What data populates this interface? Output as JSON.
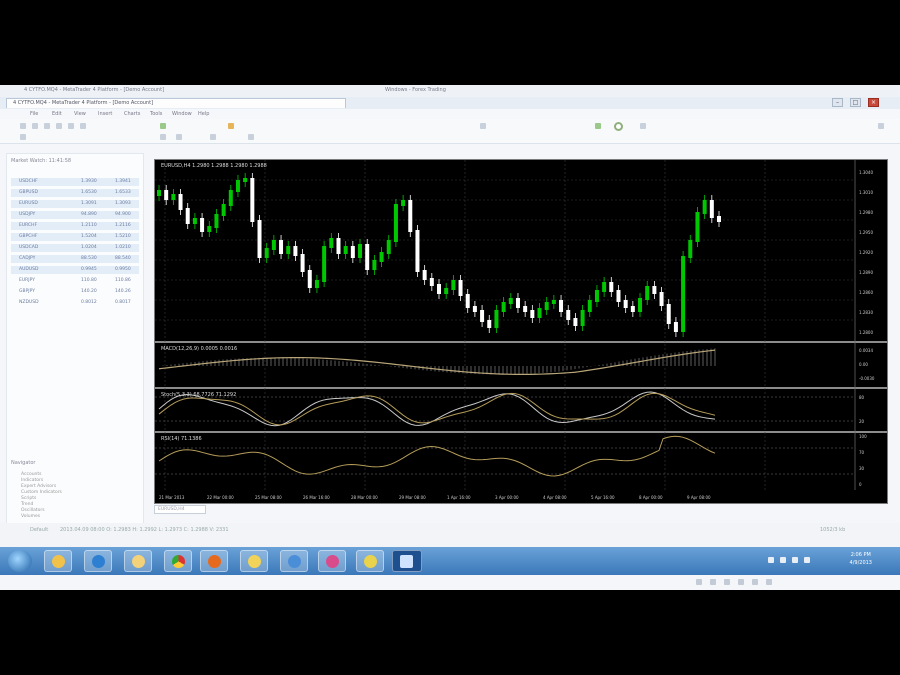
{
  "browser": {
    "window_title": "4 CYTFO.MQ4 - MetaTrader 4 Platform - [Demo Account]",
    "page_title": "Windows - Forex Trading"
  },
  "menu": {
    "items": [
      "File",
      "Edit",
      "View",
      "Insert",
      "Charts",
      "Tools",
      "Window",
      "Help"
    ]
  },
  "market_watch": {
    "title": "Market Watch: 11:41:58",
    "rows": [
      {
        "symbol": "USDCHF",
        "bid": "1.3930",
        "ask": "1.3941"
      },
      {
        "symbol": "GBPUSD",
        "bid": "1.6530",
        "ask": "1.6533"
      },
      {
        "symbol": "EURUSD",
        "bid": "1.3091",
        "ask": "1.3093"
      },
      {
        "symbol": "USDJPY",
        "bid": "94.890",
        "ask": "94.900"
      },
      {
        "symbol": "EURCHF",
        "bid": "1.2110",
        "ask": "1.2116"
      },
      {
        "symbol": "GBPCHF",
        "bid": "1.5204",
        "ask": "1.5210"
      },
      {
        "symbol": "USDCAD",
        "bid": "1.0204",
        "ask": "1.0210"
      },
      {
        "symbol": "CADJPY",
        "bid": "88.530",
        "ask": "88.540"
      },
      {
        "symbol": "AUDUSD",
        "bid": "0.9945",
        "ask": "0.9950"
      },
      {
        "symbol": "EURJPY",
        "bid": "110.80",
        "ask": "110.86"
      },
      {
        "symbol": "GBPJPY",
        "bid": "140.20",
        "ask": "140.26"
      },
      {
        "symbol": "NZDUSD",
        "bid": "0.8012",
        "ask": "0.8017"
      }
    ]
  },
  "navigator": {
    "title": "Navigator",
    "items": [
      "Accounts",
      "Indicators",
      "Expert Advisors",
      "Custom Indicators",
      "Scripts",
      "Trend",
      "Oscillators",
      "Volumes"
    ]
  },
  "chart": {
    "header": "EURUSD,H4  1.2980 1.2988 1.2980 1.2988",
    "macd_label": "MACD(12,26,9) 0.0005 0.0016",
    "stoch_label": "Stoch(5,3,3) 68.7726 71.1292",
    "rsi_label": "RSI(14) 71.1386",
    "price_ticks": [
      "1.3040",
      "1.3010",
      "1.2980",
      "1.2950",
      "1.2920",
      "1.2890",
      "1.2860",
      "1.2830",
      "1.2800"
    ],
    "macd_ticks": [
      "0.0034",
      "0.00",
      "-0.0030"
    ],
    "stoch_ticks": [
      "80",
      "20"
    ],
    "rsi_ticks": [
      "100",
      "70",
      "30",
      "0"
    ],
    "x_ticks": [
      "21 Mar 2013",
      "22 Mar 00:00",
      "25 Mar 08:00",
      "26 Mar 16:00",
      "28 Mar 00:00",
      "29 Mar 08:00",
      "1 Apr 16:00",
      "3 Apr 00:00",
      "4 Apr 08:00",
      "5 Apr 16:00",
      "8 Apr 00:00",
      "9 Apr 08:00"
    ],
    "tab": "EURUSD,H4"
  },
  "statusbar": {
    "left": "Default",
    "mid": "2013.04.09 08:00  O: 1.2983  H: 1.2992  L: 1.2973  C: 1.2988  V: 2331",
    "right": "1052/3 kb"
  },
  "taskbar": {
    "time": "2:06 PM",
    "date": "4/9/2013"
  },
  "colors": {
    "bull": "#00c800",
    "bear": "#ffffff",
    "grid": "#3a3a3a",
    "macd_signal": "#b9a77a",
    "osc_main": "#c8c8c8",
    "osc_signal": "#b49c5a"
  }
}
